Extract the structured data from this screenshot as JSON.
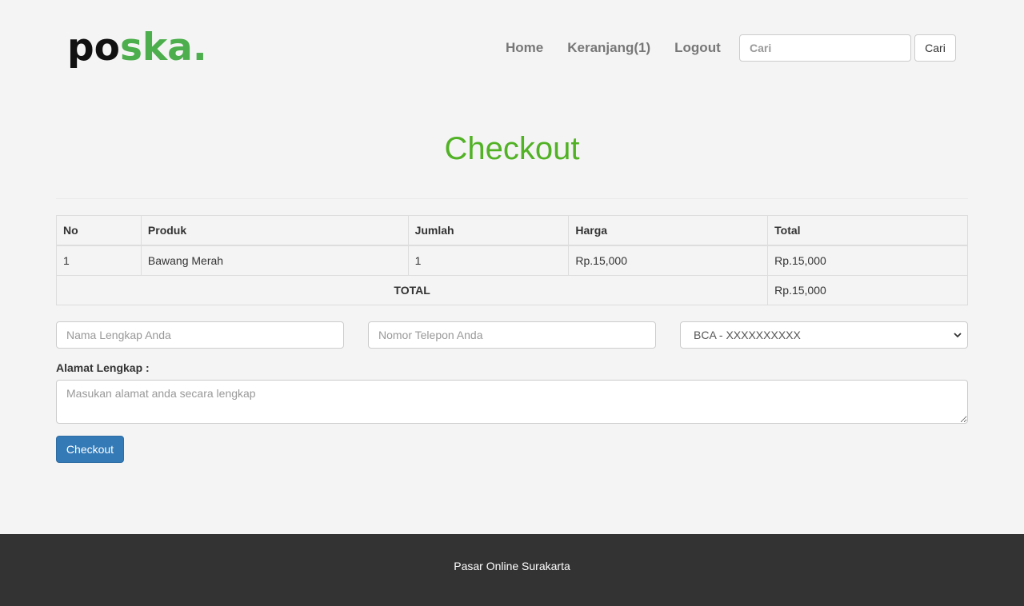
{
  "brand": {
    "logo_part1": "po",
    "logo_part2": "ska.",
    "accent_color": "#4cae4c"
  },
  "nav": {
    "items": [
      {
        "label": "Home"
      },
      {
        "label": "Keranjang(1)"
      },
      {
        "label": "Logout"
      }
    ]
  },
  "search": {
    "placeholder": "Cari",
    "button_label": "Cari"
  },
  "page": {
    "title": "Checkout",
    "title_color": "#52b226"
  },
  "table": {
    "headers": [
      "No",
      "Produk",
      "Jumlah",
      "Harga",
      "Total"
    ],
    "rows": [
      {
        "no": "1",
        "produk": "Bawang Merah",
        "jumlah": "1",
        "harga": "Rp.15,000",
        "total": "Rp.15,000"
      }
    ],
    "total_label": "TOTAL",
    "total_value": "Rp.15,000"
  },
  "form": {
    "name_placeholder": "Nama Lengkap Anda",
    "phone_placeholder": "Nomor Telepon Anda",
    "bank_selected": "BCA - XXXXXXXXXX",
    "address_label": "Alamat Lengkap :",
    "address_placeholder": "Masukan alamat anda secara lengkap",
    "submit_label": "Checkout",
    "submit_color": "#337ab7"
  },
  "footer": {
    "text": "Pasar Online Surakarta"
  }
}
